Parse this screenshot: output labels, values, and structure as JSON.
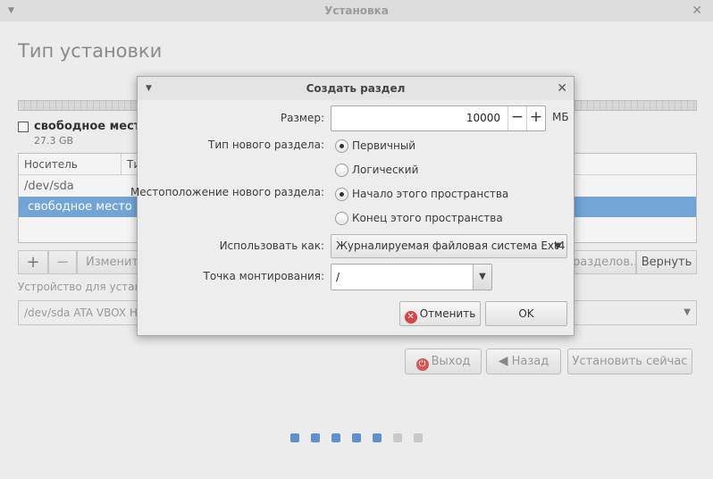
{
  "window": {
    "title": "Установка"
  },
  "main": {
    "title": "Тип установки",
    "legend": {
      "label": "свободное место",
      "size": "27.3 GB"
    },
    "table": {
      "headers": [
        "Носитель",
        "Ти"
      ],
      "rows": [
        "/dev/sda",
        "свободное место"
      ],
      "selected_row_color": "#72a5d6"
    },
    "toolbar": {
      "add": "+",
      "remove": "−",
      "change": "Изменить",
      "new_table": "разделов...",
      "revert": "Вернуть"
    },
    "boot_label": "Устройство для установ",
    "boot_value": "/dev/sda ATA VBOX HA",
    "nav": {
      "quit": "Выход",
      "back": "Назад",
      "install": "Установить сейчас"
    },
    "progress": {
      "total": 7,
      "done": 5,
      "done_color": "#5e8fcf",
      "todo_color": "#c8c8c8"
    }
  },
  "dialog": {
    "title": "Создать раздел",
    "size_label": "Размер:",
    "size_value": "10000",
    "size_unit": "МБ",
    "minus": "−",
    "plus": "+",
    "type_label": "Тип нового раздела:",
    "type_primary": "Первичный",
    "type_logical": "Логический",
    "location_label": "Местоположение нового раздела:",
    "location_start": "Начало этого пространства",
    "location_end": "Конец этого пространства",
    "use_as_label": "Использовать как:",
    "use_as_value": "Журналируемая файловая система Ext4",
    "mount_label": "Точка монтирования:",
    "mount_value": "/",
    "cancel": "Отменить",
    "ok": "OK"
  }
}
